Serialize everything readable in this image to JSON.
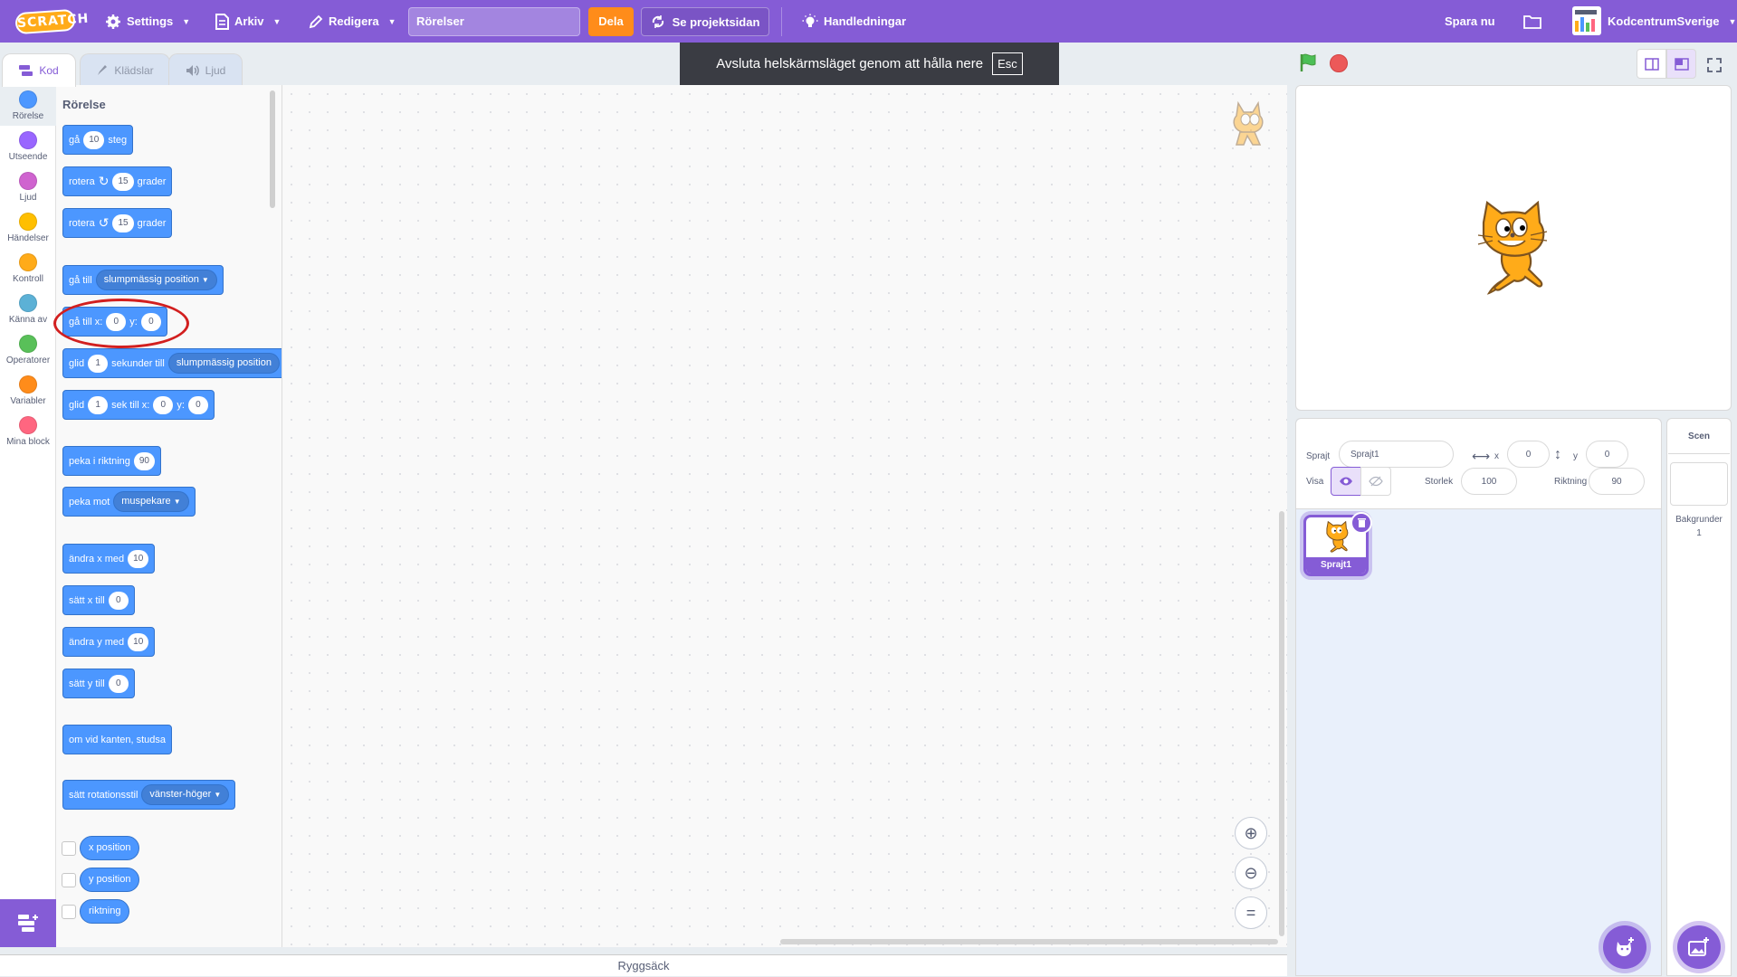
{
  "menubar": {
    "logo": "SCRATCH",
    "settings": "Settings",
    "file": "Arkiv",
    "edit": "Redigera",
    "project_title": "Rörelser",
    "share": "Dela",
    "see_project": "Se projektsidan",
    "tutorials": "Handledningar",
    "save_now": "Spara nu",
    "username": "KodcentrumSverige"
  },
  "toast": {
    "message": "Avsluta helskärmsläget genom att hålla nere",
    "key": "Esc"
  },
  "tabs": {
    "code": "Kod",
    "costumes": "Klädslar",
    "sounds": "Ljud"
  },
  "categories": [
    {
      "label": "Rörelse",
      "color": "#4c97ff"
    },
    {
      "label": "Utseende",
      "color": "#9966ff"
    },
    {
      "label": "Ljud",
      "color": "#cf63cf"
    },
    {
      "label": "Händelser",
      "color": "#ffbf00"
    },
    {
      "label": "Kontroll",
      "color": "#ffab19"
    },
    {
      "label": "Känna av",
      "color": "#5cb1d6"
    },
    {
      "label": "Operatorer",
      "color": "#59c059"
    },
    {
      "label": "Variabler",
      "color": "#ff8c1a"
    },
    {
      "label": "Mina block",
      "color": "#ff6680"
    }
  ],
  "palette": {
    "title": "Rörelse",
    "move": {
      "a": "gå",
      "v": "10",
      "b": "steg"
    },
    "turn_right": {
      "a": "rotera",
      "v": "15",
      "b": "grader"
    },
    "turn_left": {
      "a": "rotera",
      "v": "15",
      "b": "grader"
    },
    "goto": {
      "a": "gå till",
      "dd": "slumpmässig position"
    },
    "goto_xy": {
      "a": "gå till x:",
      "x": "0",
      "b": "y:",
      "y": "0"
    },
    "glide": {
      "a": "glid",
      "v": "1",
      "b": "sekunder till",
      "dd": "slumpmässig position"
    },
    "glide_xy": {
      "a": "glid",
      "v": "1",
      "b": "sek till x:",
      "x": "0",
      "c": "y:",
      "y": "0"
    },
    "point_dir": {
      "a": "peka i riktning",
      "v": "90"
    },
    "point_towards": {
      "a": "peka mot",
      "dd": "muspekare"
    },
    "change_x": {
      "a": "ändra x med",
      "v": "10"
    },
    "set_x": {
      "a": "sätt x till",
      "v": "0"
    },
    "change_y": {
      "a": "ändra y med",
      "v": "10"
    },
    "set_y": {
      "a": "sätt y till",
      "v": "0"
    },
    "bounce": {
      "a": "om vid kanten, studsa"
    },
    "rotstyle": {
      "a": "sätt rotationsstil",
      "dd": "vänster-höger"
    },
    "reporters": [
      "x position",
      "y position",
      "riktning"
    ]
  },
  "backpack": "Ryggsäck",
  "sprite_info": {
    "sprite_label": "Sprajt",
    "sprite_name": "Sprajt1",
    "x_label": "x",
    "x": "0",
    "y_label": "y",
    "y": "0",
    "show_label": "Visa",
    "size_label": "Storlek",
    "size": "100",
    "direction_label": "Riktning",
    "direction": "90"
  },
  "sprites": [
    {
      "name": "Sprajt1"
    }
  ],
  "stage_pane": {
    "title": "Scen",
    "backdrops_label": "Bakgrunder",
    "backdrops_count": "1"
  },
  "colors": {
    "accent": "#855cd6",
    "motion": "#4c97ff",
    "share": "#ff8c1a",
    "highlight": "#d21f1f"
  }
}
